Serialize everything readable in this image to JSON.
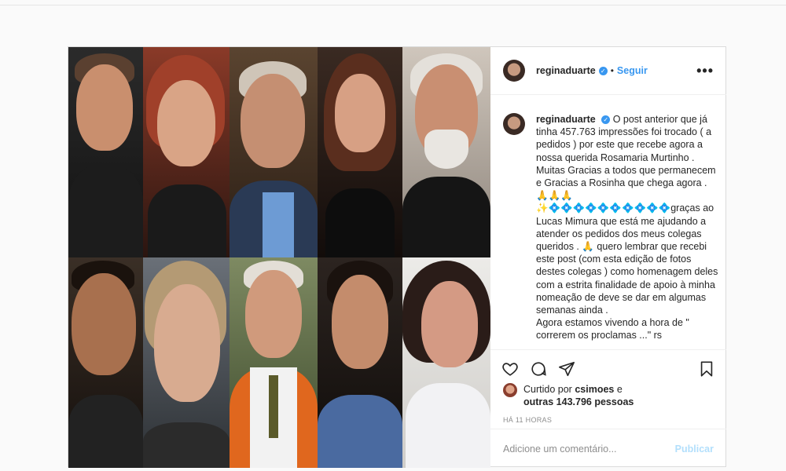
{
  "post": {
    "username": "reginaduarte",
    "follow_label": "Seguir",
    "more_label": "•••",
    "caption_segments": [
      "O post anterior que já tinha 457.763 impressões foi trocado ( a pedidos ) por este que recebe agora a nossa querida Rosamaria Murtinho . Muitas Gracias a todos que permanecem e Gracias a Rosinha que chega agora . 🙏🙏🙏✨💠💠💠💠💠💠💠💠💠💠graças ao Lucas Mimura que está me ajudando a atender os pedidos dos meus colegas queridos .",
      "🙏 quero lembrar que recebi este post (com esta edição de fotos destes colegas ) como homenagem deles com a estrita finalidade de apoio à minha nomeação de deve se dar em algumas semanas ainda .",
      "Agora estamos vivendo a hora de \" correrem os proclamas ...\" rs"
    ],
    "liked_by_prefix": "Curtido por",
    "liked_by_user": "csimoes",
    "liked_by_connector": "e",
    "liked_by_others": "outras 143.796 pessoas",
    "timestamp": "HÁ 11 HORAS",
    "comment_placeholder": "Adicione um comentário...",
    "publish_label": "Publicar"
  },
  "icons": {
    "verified": "verified-badge-icon",
    "like": "heart-icon",
    "comment": "comment-bubble-icon",
    "share": "paper-plane-icon",
    "save": "bookmark-icon"
  },
  "colors": {
    "accent": "#3897f0",
    "publish_disabled": "#b2dffc",
    "muted": "#8e8e8e",
    "border": "#dbdbdb"
  }
}
